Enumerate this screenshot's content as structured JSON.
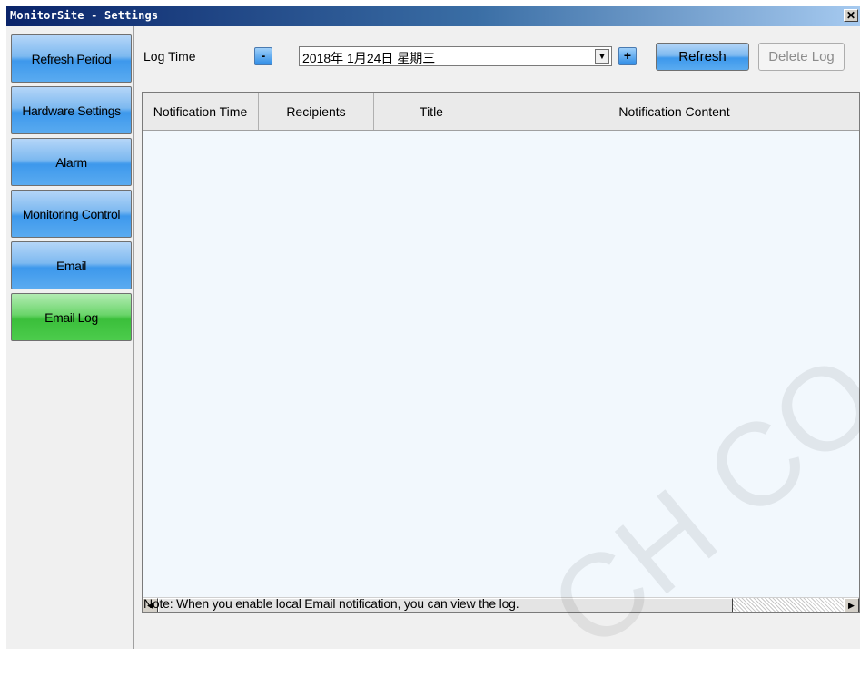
{
  "window": {
    "title": "MonitorSite - Settings",
    "close_glyph": "✕"
  },
  "sidebar": {
    "items": [
      {
        "label": "Refresh Period",
        "active": false
      },
      {
        "label": "Hardware Settings",
        "active": false
      },
      {
        "label": "Alarm",
        "active": false
      },
      {
        "label": "Monitoring Control",
        "active": false
      },
      {
        "label": "Email",
        "active": false
      },
      {
        "label": "Email Log",
        "active": true
      }
    ],
    "active_color": "#4ccc4c",
    "inactive_color": "#3d98ec"
  },
  "toolbar": {
    "log_time_label": "Log Time",
    "decrement_label": "-",
    "date_value": "2018年 1月24日 星期三",
    "increment_label": "+",
    "refresh_label": "Refresh",
    "delete_label": "Delete Log"
  },
  "table": {
    "columns": [
      "Notification Time",
      "Recipients",
      "Title",
      "Notification Content"
    ],
    "rows": []
  },
  "note": "Note: When you enable local Email notification, you can view the log.",
  "watermark": "CH CO., LT"
}
